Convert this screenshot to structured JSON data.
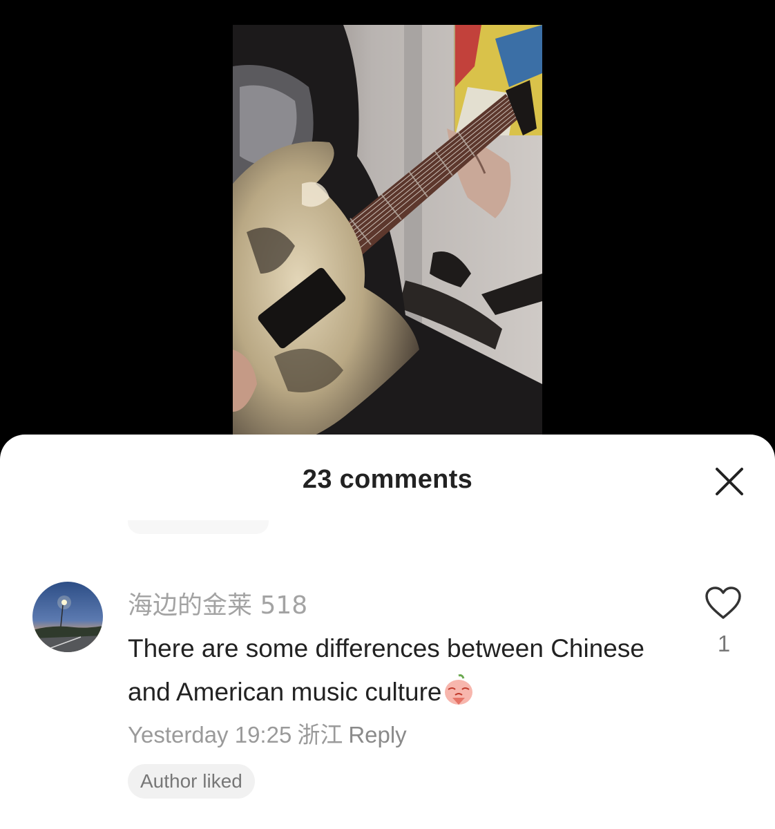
{
  "video": {
    "subject": "guitar-performance-video"
  },
  "comments_sheet": {
    "title": "23 comments",
    "close_icon": "close-icon"
  },
  "comment": {
    "username": "海边的金莱 518",
    "text": "There are some differences between Chinese and American music culture",
    "emoji_icon": "praying-peach-emoji",
    "time": "Yesterday 19:25",
    "location": "浙江",
    "reply_label": "Reply",
    "badge": "Author liked",
    "like_icon": "heart-outline-icon",
    "like_count": "1"
  },
  "colors": {
    "sheet_background": "#ffffff",
    "backdrop": "#000000",
    "muted_text": "#9a9a9a",
    "primary_text": "#222222"
  }
}
